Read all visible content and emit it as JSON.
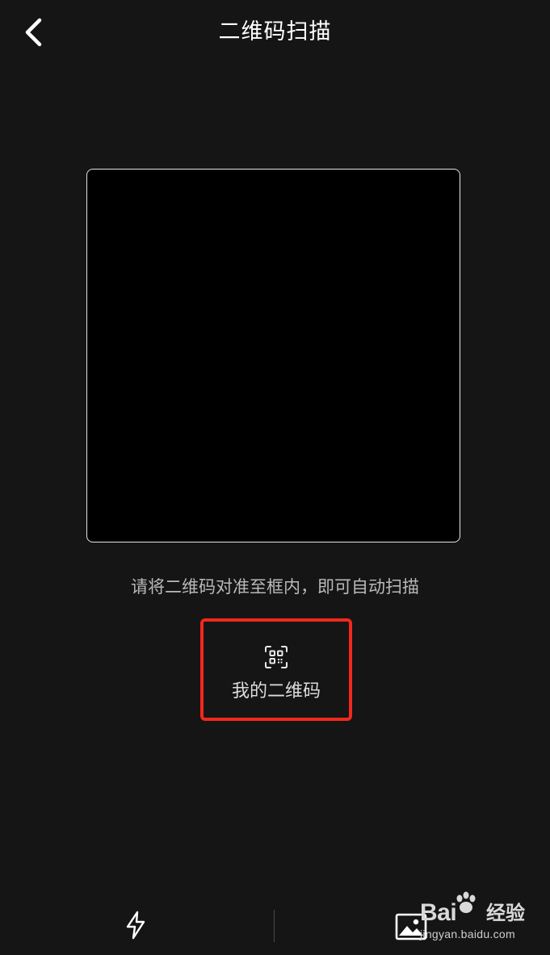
{
  "header": {
    "title": "二维码扫描",
    "back_icon": "chevron-left-icon"
  },
  "scanner": {
    "hint": "请将二维码对准至框内，即可自动扫描"
  },
  "my_qr": {
    "label": "我的二维码",
    "icon": "qr-code-icon",
    "highlight_color": "#f2281c"
  },
  "bottom_bar": {
    "flash_icon": "lightning-icon",
    "gallery_icon": "image-icon"
  },
  "watermark": {
    "brand": "Bai",
    "brand_suffix": "经验",
    "url": "jingyan.baidu.com"
  },
  "colors": {
    "background": "#151515",
    "scan_frame": "#000000",
    "scan_frame_border": "#e6e6e6"
  }
}
